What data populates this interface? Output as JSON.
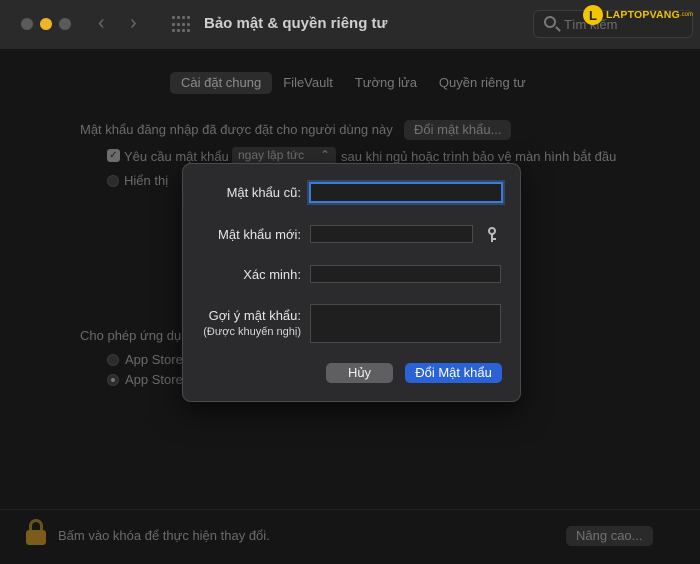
{
  "window": {
    "title": "Bảo mật & quyền riêng tư",
    "search_placeholder": "Tìm kiếm",
    "logo_text": "LAPTOPVANG",
    "logo_suffix": ".com"
  },
  "tabs": [
    {
      "label": "Cài đặt chung",
      "active": true
    },
    {
      "label": "FileVault",
      "active": false
    },
    {
      "label": "Tường lửa",
      "active": false
    },
    {
      "label": "Quyền riêng tư",
      "active": false
    }
  ],
  "general": {
    "password_set_text": "Mật khẩu đăng nhập đã được đặt cho người dùng này",
    "change_password_button": "Đổi mật khẩu...",
    "require_password_label": "Yêu cầu mật khẩu",
    "require_password_checked": true,
    "require_password_value": "ngay lập tức",
    "require_password_suffix": "sau khi ngủ hoặc trình bảo vệ màn hình bắt đầu",
    "show_message_partial": "Hiển thị",
    "allow_apps_partial": "Cho phép ứng dụ",
    "app_store_option_1": "App Store",
    "app_store_option_2": "App Store"
  },
  "footer": {
    "lock_text": "Bấm vào khóa để thực hiện thay đổi.",
    "advanced_button": "Nâng cao..."
  },
  "dialog": {
    "old_password_label": "Mật khẩu cũ:",
    "new_password_label": "Mật khẩu mới:",
    "verify_label": "Xác minh:",
    "hint_label": "Gợi ý mật khẩu:",
    "hint_sublabel": "(Được khuyến nghị)",
    "old_password_value": "",
    "new_password_value": "",
    "verify_value": "",
    "hint_value": "",
    "cancel_button": "Hủy",
    "confirm_button": "Đổi Mật khẩu"
  },
  "colors": {
    "accent": "#2a63d6",
    "focus_ring": "#3d7bd7",
    "minimize": "#f0b429",
    "logo": "#f3c400"
  }
}
